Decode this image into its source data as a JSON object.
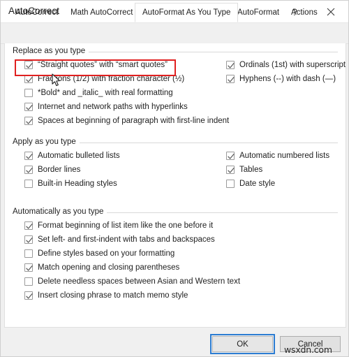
{
  "window": {
    "title": "AutoCorrect",
    "help_icon": "question-mark-icon",
    "help_glyph": "?",
    "close_icon": "close-icon"
  },
  "tabs": [
    {
      "label": "AutoCorrect",
      "active": false
    },
    {
      "label": "Math AutoCorrect",
      "active": false
    },
    {
      "label": "AutoFormat As You Type",
      "active": true
    },
    {
      "label": "AutoFormat",
      "active": false
    },
    {
      "label": "Actions",
      "active": false
    }
  ],
  "groups": [
    {
      "title": "Replace as you type",
      "left_column": [
        {
          "label": "“Straight quotes” with “smart quotes”",
          "checked": true,
          "highlighted": true
        },
        {
          "label": "Fractions (1/2) with fraction character (½)",
          "checked": true,
          "highlighted": false
        },
        {
          "label": "*Bold* and _italic_ with real formatting",
          "checked": false,
          "highlighted": false
        },
        {
          "label": "Internet and network paths with hyperlinks",
          "checked": true,
          "highlighted": false
        },
        {
          "label": "Spaces at beginning of paragraph with first-line indent",
          "checked": true,
          "highlighted": false
        }
      ],
      "right_column": [
        {
          "label": "Ordinals (1st) with superscript",
          "checked": true
        },
        {
          "label": "Hyphens (--) with dash (—)",
          "checked": true
        }
      ]
    },
    {
      "title": "Apply as you type",
      "left_column": [
        {
          "label": "Automatic bulleted lists",
          "checked": true
        },
        {
          "label": "Border lines",
          "checked": true
        },
        {
          "label": "Built-in Heading styles",
          "checked": false
        }
      ],
      "right_column": [
        {
          "label": "Automatic numbered lists",
          "checked": true
        },
        {
          "label": "Tables",
          "checked": true
        },
        {
          "label": "Date style",
          "checked": false
        }
      ]
    },
    {
      "title": "Automatically as you type",
      "left_column": [
        {
          "label": "Format beginning of list item like the one before it",
          "checked": true
        },
        {
          "label": "Set left- and first-indent with tabs and backspaces",
          "checked": true
        },
        {
          "label": "Define styles based on your formatting",
          "checked": false
        },
        {
          "label": "Match opening and closing parentheses",
          "checked": true
        },
        {
          "label": "Delete needless spaces between Asian and Western text",
          "checked": false
        },
        {
          "label": "Insert closing phrase to match memo style",
          "checked": true
        }
      ],
      "right_column": []
    }
  ],
  "footer": {
    "ok_label": "OK",
    "cancel_label": "Cancel"
  },
  "overlay": {
    "watermark_text": "wsxdn.com",
    "highlight_color": "#e02020",
    "cursor_icon": "mouse-pointer-icon"
  }
}
